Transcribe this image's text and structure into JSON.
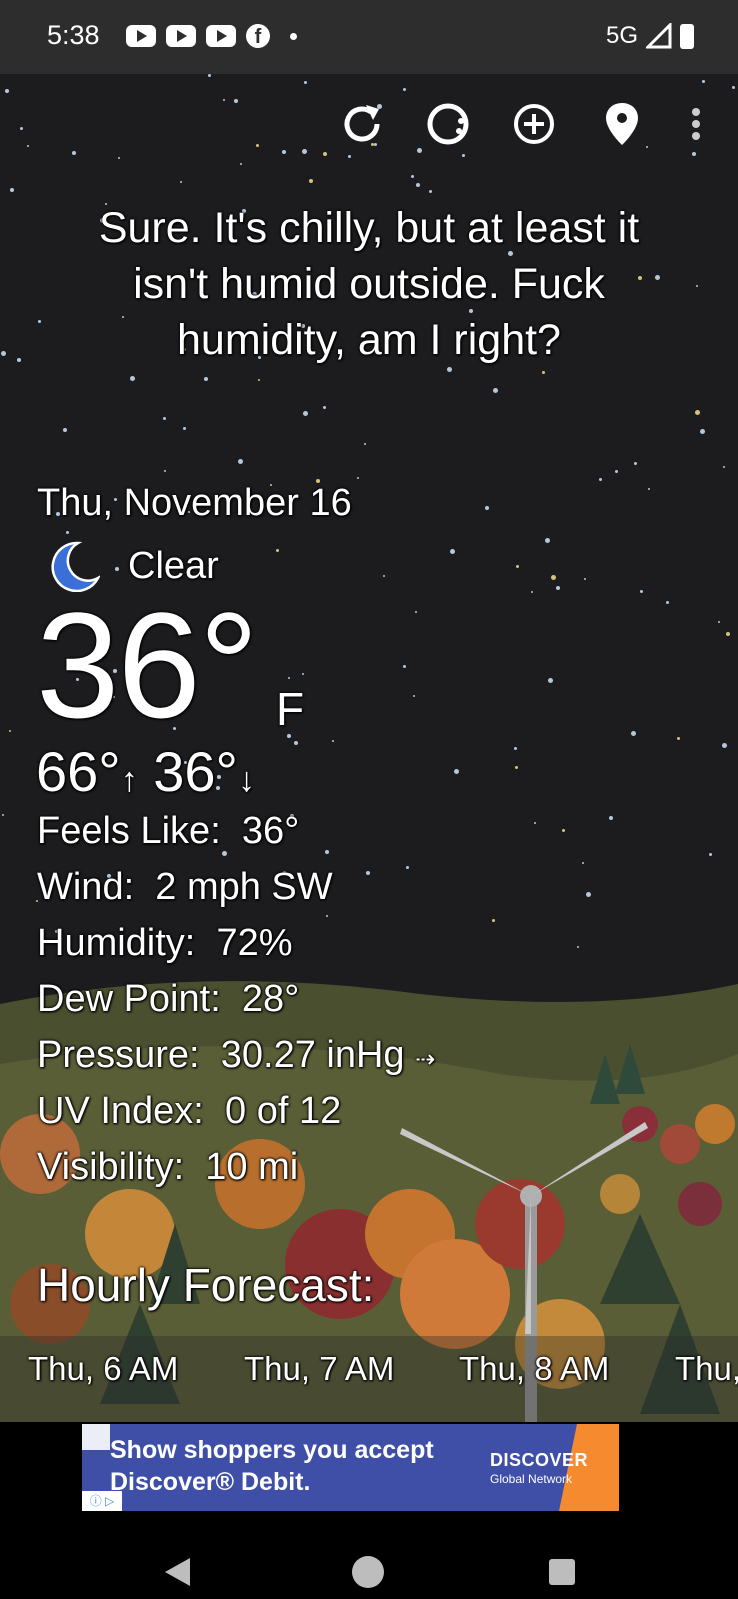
{
  "status_bar": {
    "time": "5:38",
    "network": "5G",
    "notification_icons": [
      "youtube-icon",
      "youtube-icon",
      "youtube-icon",
      "facebook-icon",
      "dot-icon"
    ]
  },
  "toolbar": {
    "icons": [
      "refresh-icon",
      "theme-icon",
      "add-location-icon",
      "location-pin-icon",
      "more-vert-icon"
    ]
  },
  "quip": "Sure. It's chilly, but at least it isn't humid outside. Fuck humidity, am I right?",
  "current": {
    "date": "Thu, November 16",
    "condition": "Clear",
    "condition_icon": "moon-icon",
    "temperature": "36°",
    "unit": "F",
    "high": "66°",
    "low": "36°"
  },
  "details": [
    {
      "label": "Feels Like:",
      "value": "36°"
    },
    {
      "label": "Wind:",
      "value": "2 mph SW"
    },
    {
      "label": "Humidity:",
      "value": "72%"
    },
    {
      "label": "Dew Point:",
      "value": "28°"
    },
    {
      "label": "Pressure:",
      "value": "30.27 inHg"
    },
    {
      "label": "UV Index:",
      "value": "0 of 12"
    },
    {
      "label": "Visibility:",
      "value": "10 mi"
    }
  ],
  "hourly": {
    "title": "Hourly Forecast:",
    "items": [
      "Thu, 6 AM",
      "Thu, 7 AM",
      "Thu, 8 AM",
      "Thu,"
    ]
  },
  "ad": {
    "headline_line1": "Show shoppers you accept",
    "headline_line2": "Discover® Debit.",
    "brand": "DISCOVER",
    "brand_sub": "Global Network"
  },
  "colors": {
    "sky": "#1c1c1e",
    "moon": "#3a6fd8",
    "ad_bg": "#3f4fa8",
    "ad_accent": "#f58a2f"
  }
}
